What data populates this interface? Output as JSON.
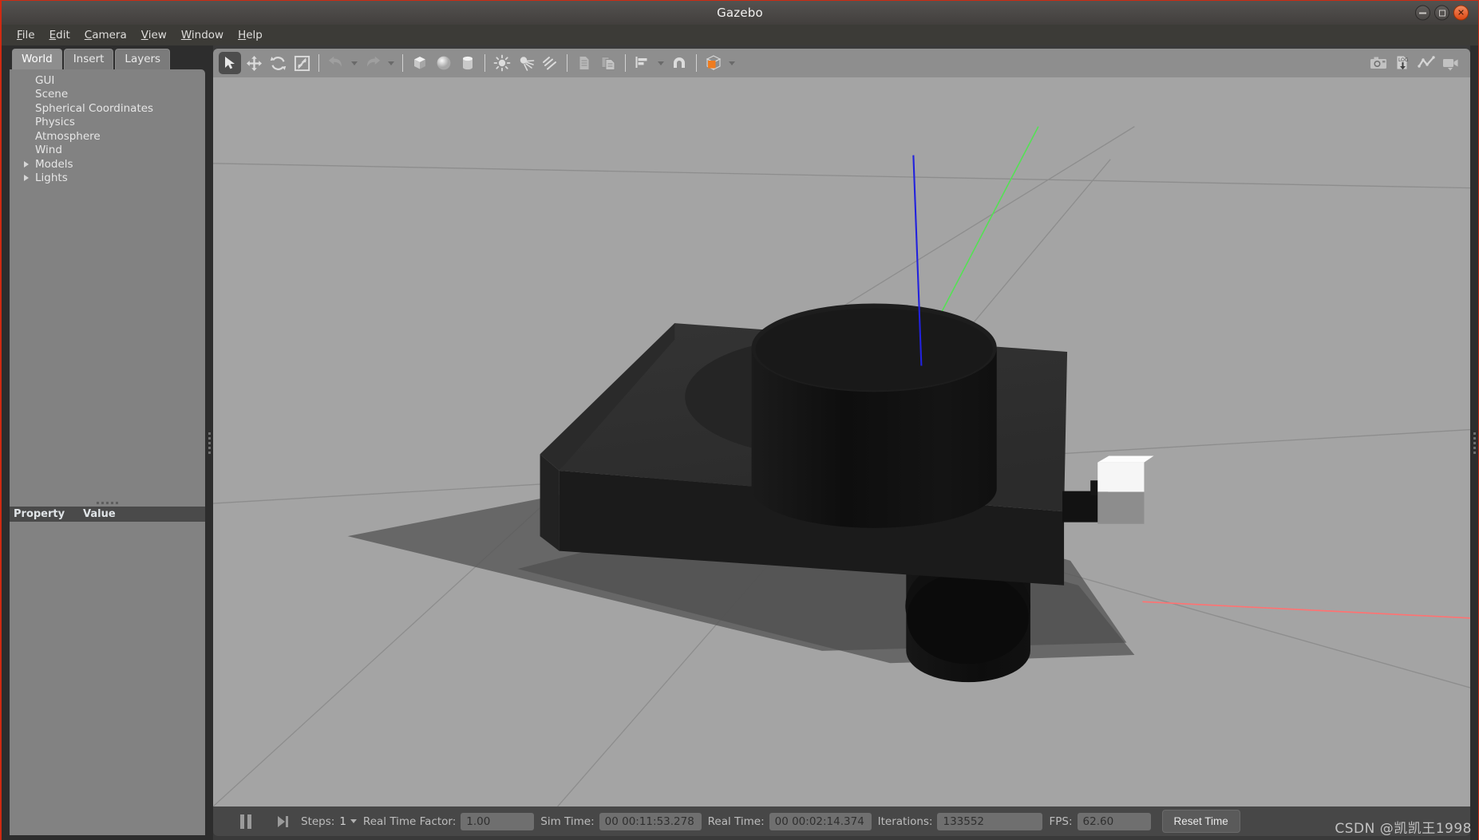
{
  "window": {
    "title": "Gazebo",
    "controls": [
      {
        "name": "minimize",
        "glyph": "—"
      },
      {
        "name": "maximize",
        "glyph": "□"
      },
      {
        "name": "close",
        "glyph": "✕"
      }
    ]
  },
  "menubar": {
    "items": [
      {
        "label": "File",
        "mnemonic": "F"
      },
      {
        "label": "Edit",
        "mnemonic": "E"
      },
      {
        "label": "Camera",
        "mnemonic": "C"
      },
      {
        "label": "View",
        "mnemonic": "V"
      },
      {
        "label": "Window",
        "mnemonic": "W"
      },
      {
        "label": "Help",
        "mnemonic": "H"
      }
    ]
  },
  "left_panel": {
    "tabs": [
      {
        "label": "World",
        "active": true
      },
      {
        "label": "Insert",
        "active": false
      },
      {
        "label": "Layers",
        "active": false
      }
    ],
    "tree": [
      {
        "label": "GUI",
        "expandable": false
      },
      {
        "label": "Scene",
        "expandable": false
      },
      {
        "label": "Spherical Coordinates",
        "expandable": false
      },
      {
        "label": "Physics",
        "expandable": false
      },
      {
        "label": "Atmosphere",
        "expandable": false
      },
      {
        "label": "Wind",
        "expandable": false
      },
      {
        "label": "Models",
        "expandable": true
      },
      {
        "label": "Lights",
        "expandable": true
      }
    ],
    "property_table": {
      "columns": [
        "Property",
        "Value"
      ],
      "rows": []
    }
  },
  "toolbar": {
    "left_tools": [
      {
        "name": "select-mode",
        "icon": "cursor-arrow-icon",
        "active": true
      },
      {
        "name": "translate-mode",
        "icon": "move-arrows-icon",
        "active": false
      },
      {
        "name": "rotate-mode",
        "icon": "rotate-icon",
        "active": false
      },
      {
        "name": "scale-mode",
        "icon": "scale-icon",
        "active": false
      },
      {
        "name": "undo",
        "icon": "undo-arrow-icon",
        "active": false
      },
      {
        "name": "undo-history",
        "icon": "chevron-down-icon",
        "active": false
      },
      {
        "name": "redo",
        "icon": "redo-arrow-icon",
        "active": false
      },
      {
        "name": "redo-history",
        "icon": "chevron-down-icon",
        "active": false
      },
      {
        "name": "insert-box",
        "icon": "cube-icon",
        "active": false
      },
      {
        "name": "insert-sphere",
        "icon": "sphere-icon",
        "active": false
      },
      {
        "name": "insert-cylinder",
        "icon": "cylinder-icon",
        "active": false
      },
      {
        "name": "insert-point-light",
        "icon": "point-light-icon",
        "active": false
      },
      {
        "name": "insert-spot-light",
        "icon": "spot-light-icon",
        "active": false
      },
      {
        "name": "insert-directional-light",
        "icon": "directional-light-icon",
        "active": false
      },
      {
        "name": "copy",
        "icon": "copy-icon",
        "active": false
      },
      {
        "name": "paste",
        "icon": "paste-icon",
        "active": false
      },
      {
        "name": "align",
        "icon": "align-icon",
        "active": false
      },
      {
        "name": "snap",
        "icon": "magnet-icon",
        "active": false
      },
      {
        "name": "view-mode",
        "icon": "orange-cube-icon",
        "active": false
      }
    ],
    "right_tools": [
      {
        "name": "screenshot",
        "icon": "camera-icon"
      },
      {
        "name": "log-record",
        "icon": "log-download-icon"
      },
      {
        "name": "plot",
        "icon": "line-chart-icon"
      },
      {
        "name": "video-record",
        "icon": "video-camera-icon"
      }
    ]
  },
  "status_bar": {
    "pause_button": "pause-icon",
    "step_button": "step-forward-icon",
    "steps_label": "Steps:",
    "steps_value": "1",
    "real_time_factor_label": "Real Time Factor:",
    "real_time_factor_value": "1.00",
    "sim_time_label": "Sim Time:",
    "sim_time_value": "00 00:11:53.278",
    "real_time_label": "Real Time:",
    "real_time_value": "00 00:02:14.374",
    "iterations_label": "Iterations:",
    "iterations_value": "133552",
    "fps_label": "FPS:",
    "fps_value": "62.60",
    "reset_time_label": "Reset Time"
  },
  "viewport": {
    "description": "3D simulation scene with dark robot chassis, cylinder body, white sensor cube and wheel on a gray ground plane",
    "background_color": "#a2a2a2",
    "ground_color": "#a5a5a5",
    "axis_colors": {
      "x": "#ff6b6b",
      "y": "#5bd75b",
      "z": "#2222dd"
    },
    "grid_color": "#8b8b8b",
    "objects": [
      {
        "name": "chassis-box",
        "color": "#2c2c2c"
      },
      {
        "name": "body-cylinder",
        "color": "#141414"
      },
      {
        "name": "sensor-cube",
        "color": "#f0f0f0"
      },
      {
        "name": "wheel-cylinder",
        "color": "#131313"
      },
      {
        "name": "ground-shadow",
        "color": "#4f4f4f"
      }
    ]
  },
  "watermark": {
    "text": "CSDN @凯凯王1998"
  }
}
